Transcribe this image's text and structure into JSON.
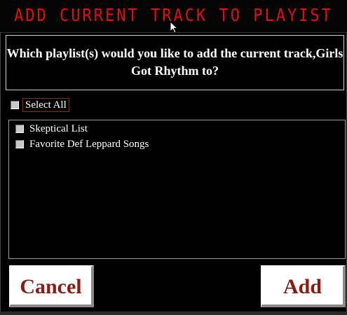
{
  "window": {
    "title": "ADD CURRENT TRACK TO PLAYIST"
  },
  "prompt": {
    "line1": "Which playlist(s) would you like to add the current track,Girls",
    "line2": "Got Rhythm to?"
  },
  "select_all": {
    "label": "Select All",
    "checked": false
  },
  "playlists": [
    {
      "label": "Skeptical List",
      "checked": false
    },
    {
      "label": "Favorite Def Leppard Songs",
      "checked": false
    }
  ],
  "buttons": {
    "cancel_label": "Cancel",
    "add_label": "Add"
  },
  "colors": {
    "title_red": "#e01010",
    "button_text": "#8b1a10",
    "background": "#000000"
  }
}
